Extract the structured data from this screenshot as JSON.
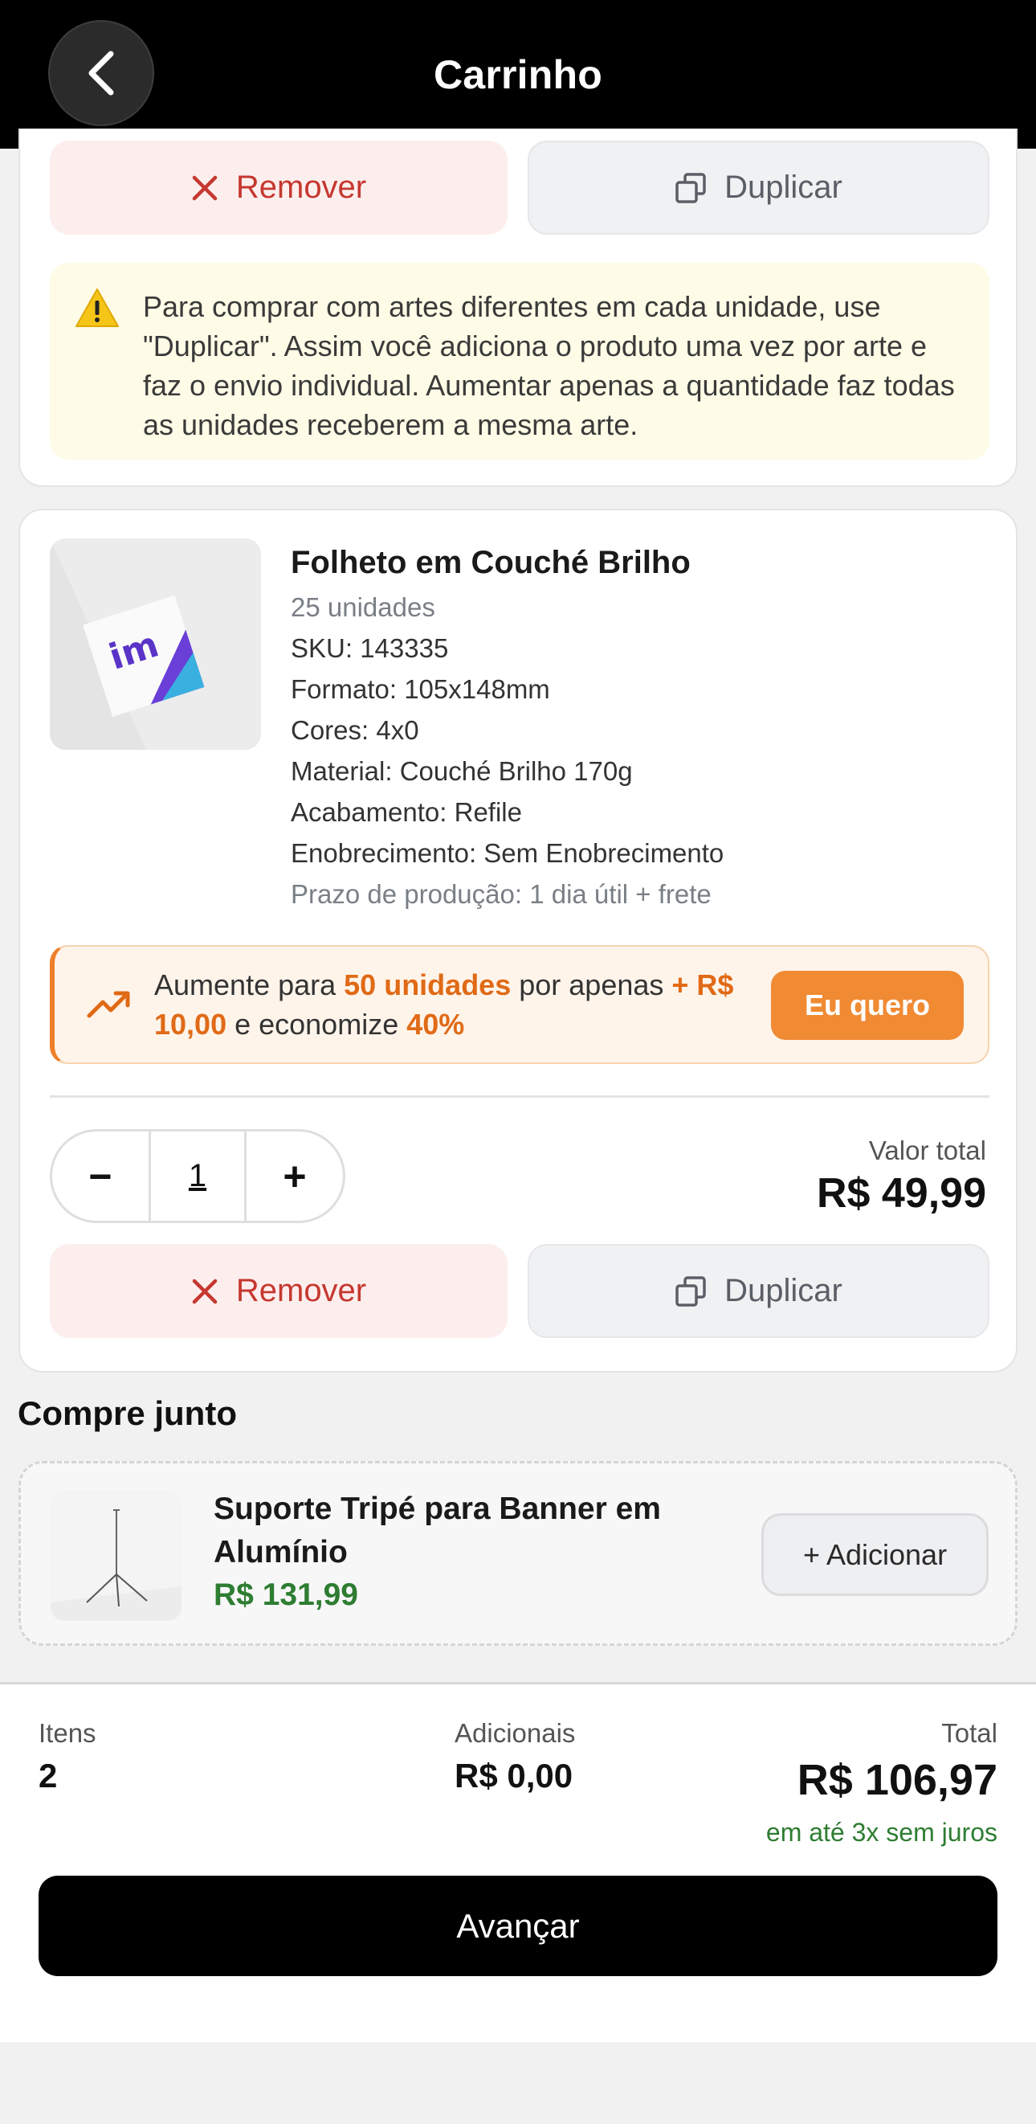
{
  "header": {
    "title": "Carrinho"
  },
  "card1": {
    "remove_label": "Remover",
    "duplicate_label": "Duplicar",
    "warning_text": "Para comprar com artes diferentes em cada unidade, use \"Duplicar\". Assim você adiciona o produto uma vez por arte e faz o envio individual. Aumentar apenas a quantidade faz todas as unidades receberem a mesma arte."
  },
  "product": {
    "title": "Folheto em Couché Brilho",
    "units": "25 unidades",
    "sku": "SKU: 143335",
    "format": "Formato: 105x148mm",
    "colors": "Cores: 4x0",
    "material": "Material: Couché Brilho 170g",
    "finish": "Acabamento: Refile",
    "enhancement": "Enobrecimento: Sem Enobrecimento",
    "lead_time": "Prazo de produção: 1 dia útil + frete",
    "upsell": {
      "prefix": "Aumente para ",
      "units": "50 unidades",
      "middle": " por apenas ",
      "price": "+ R$ 10,00",
      "middle2": " e economize ",
      "discount": "40%",
      "button": "Eu quero"
    },
    "quantity": "1",
    "minus": "−",
    "plus": "+",
    "total_label": "Valor total",
    "total_value": "R$ 49,99",
    "remove_label": "Remover",
    "duplicate_label": "Duplicar"
  },
  "compre_junto": {
    "title": "Compre junto",
    "item_name": "Suporte Tripé para Banner em Alumínio",
    "item_price": "R$ 131,99",
    "add_label": "+ Adicionar"
  },
  "footer": {
    "items_label": "Itens",
    "items_value": "2",
    "extras_label": "Adicionais",
    "extras_value": "R$ 0,00",
    "total_label": "Total",
    "total_value": "R$ 106,97",
    "installments": "em até 3x sem juros",
    "advance_label": "Avançar"
  },
  "colors": {
    "accent_orange": "#f08a33",
    "remove_red": "#c5382f",
    "price_green": "#2e7d32",
    "warning_bg": "#fefbe6"
  }
}
